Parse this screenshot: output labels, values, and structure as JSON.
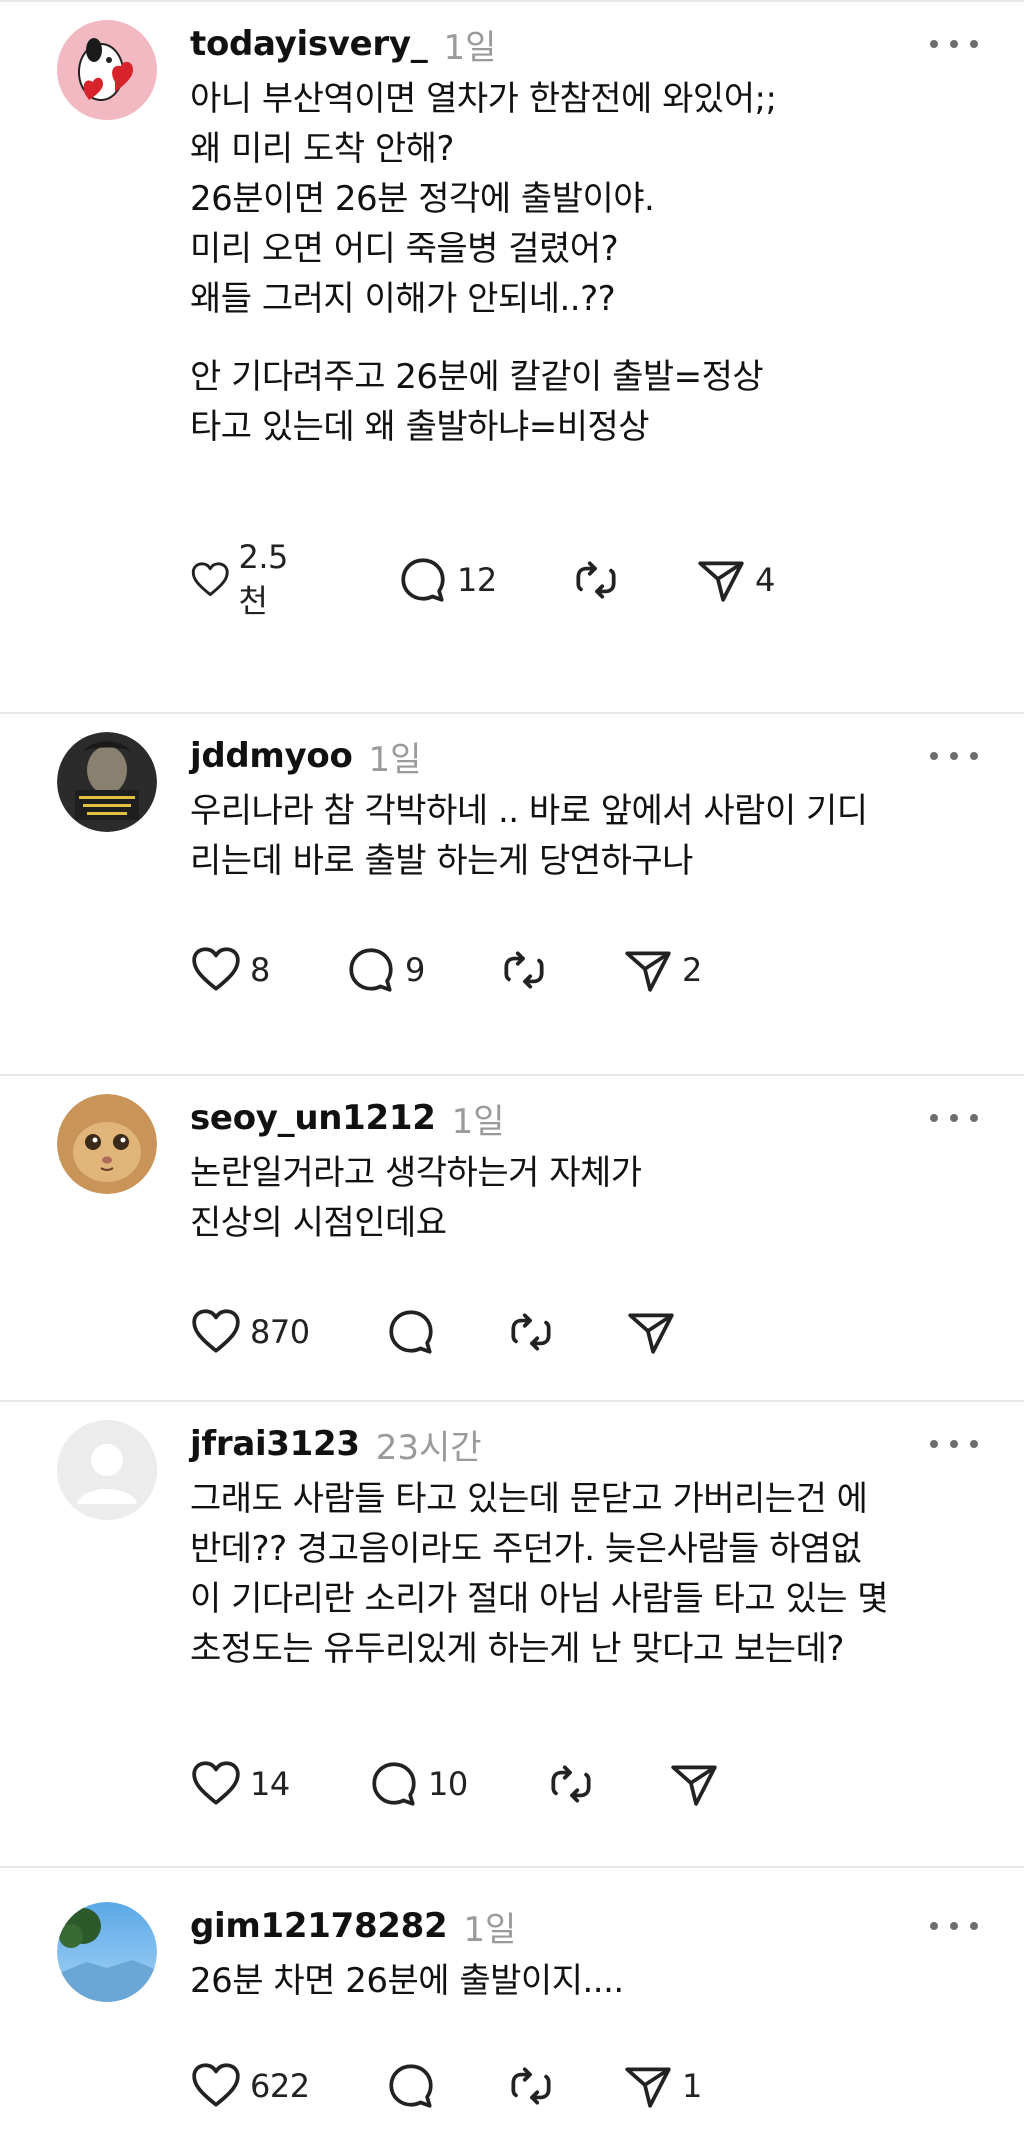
{
  "posts": [
    {
      "username": "todayisvery_",
      "time": "1일",
      "avatar_icon": "snoopy-heart-avatar",
      "lines": [
        "아니 부산역이면 열차가 한참전에 와있어;;",
        "왜 미리 도착 안해?",
        "26분이면 26분 정각에 출발이야.",
        "미리 오면 어디 죽을병 걸렸어?",
        "왜들 그러지 이해가 안되네..??"
      ],
      "lines2": [
        "안 기다려주고 26분에 칼같이 출발=정상",
        "타고 있는데 왜 출발하냐=비정상"
      ],
      "likes": "2.5천",
      "comments": "12",
      "reposts": "",
      "shares": "4"
    },
    {
      "username": "jddmyoo",
      "time": "1일",
      "avatar_icon": "portrait-avatar",
      "lines": [
        "우리나라 참 각박하네 .. 바로 앞에서 사람이 기디",
        "리는데 바로 출발 하는게 당연하구나"
      ],
      "likes": "8",
      "comments": "9",
      "reposts": "",
      "shares": "2"
    },
    {
      "username": "seoy_un1212",
      "time": "1일",
      "avatar_icon": "cat-avatar",
      "lines": [
        "논란일거라고 생각하는거 자체가",
        "진상의 시점인데요"
      ],
      "likes": "870",
      "comments": "",
      "reposts": "",
      "shares": ""
    },
    {
      "username": "jfrai3123",
      "time": "23시간",
      "avatar_icon": "default-user-avatar",
      "lines": [
        "그래도 사람들 타고 있는데 문닫고 가버리는건 에",
        "반데?? 경고음이라도 주던가. 늦은사람들 하염없",
        "이 기다리란 소리가 절대 아님 사람들 타고 있는 몇",
        "초정도는 유두리있게 하는게 난 맞다고 보는데?"
      ],
      "likes": "14",
      "comments": "10",
      "reposts": "",
      "shares": ""
    },
    {
      "username": "gim12178282",
      "time": "1일",
      "avatar_icon": "landscape-avatar",
      "lines": [
        "26분 차면 26분에 출발이지...."
      ],
      "likes": "622",
      "comments": "",
      "reposts": "",
      "shares": "1"
    }
  ],
  "colors": {
    "text": "#111111",
    "muted": "#9a9a9a",
    "icon": "#222222",
    "divider": "#e8e8e8"
  }
}
